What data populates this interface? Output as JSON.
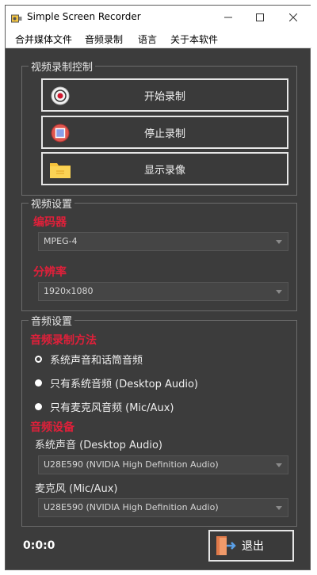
{
  "window": {
    "title": "Simple Screen Recorder"
  },
  "menu": [
    "合并媒体文件",
    "音频录制",
    "语言",
    "关于本软件"
  ],
  "video_control": {
    "title": "视频录制控制",
    "start_label": "开始录制",
    "stop_label": "停止录制",
    "show_label": "显示录像"
  },
  "video_settings": {
    "title": "视频设置",
    "encoder_label": "编码器",
    "encoder_value": "MPEG-4",
    "resolution_label": "分辨率",
    "resolution_value": "1920x1080"
  },
  "audio_settings": {
    "title": "音频设置",
    "method_label": "音频录制方法",
    "options": [
      {
        "label": "系统声音和话筒音频",
        "selected": true
      },
      {
        "label": "只有系统音频 (Desktop Audio)",
        "selected": false
      },
      {
        "label": "只有麦克风音频 (Mic/Aux)",
        "selected": false
      }
    ],
    "device_label": "音频设备",
    "system_sound_label": "系统声音 (Desktop Audio)",
    "system_sound_value": "U28E590 (NVIDIA High Definition Audio)",
    "mic_label": "麦克风 (Mic/Aux)",
    "mic_value": "U28E590 (NVIDIA High Definition Audio)"
  },
  "footer": {
    "timer": "0:0:0",
    "exit_label": "退出"
  },
  "colors": {
    "accent_red": "#e0203a",
    "panel_bg": "#3c3c3c"
  }
}
